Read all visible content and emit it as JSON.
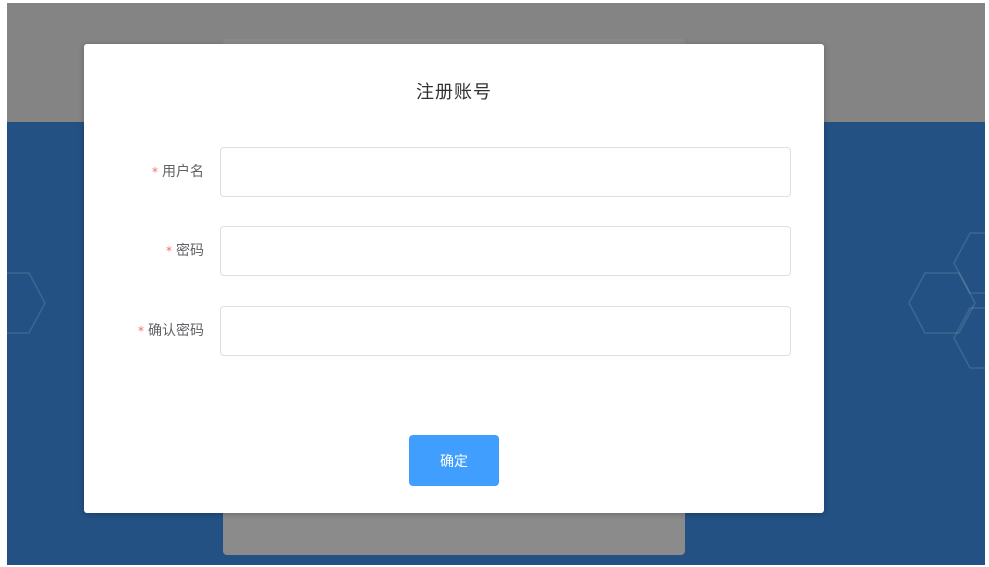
{
  "dialog": {
    "title": "注册账号",
    "fields": [
      {
        "required_mark": "*",
        "label": "用户名",
        "value": "",
        "placeholder": ""
      },
      {
        "required_mark": "*",
        "label": "密码",
        "value": "",
        "placeholder": ""
      },
      {
        "required_mark": "*",
        "label": "确认密码",
        "value": "",
        "placeholder": ""
      }
    ],
    "confirm_label": "确定"
  },
  "colors": {
    "backdrop_blue": "#235183",
    "backdrop_gray": "#848484",
    "primary_button": "#409eff",
    "required_mark": "#f56c6c"
  }
}
